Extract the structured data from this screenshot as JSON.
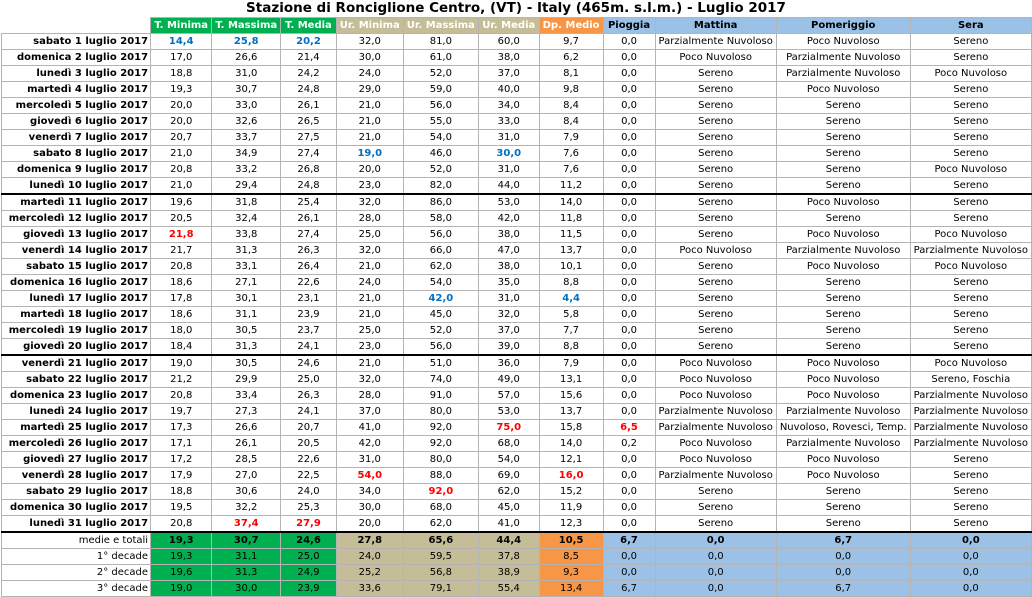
{
  "title": "Stazione di Ronciglione Centro, (VT) - Italy (465m. s.l.m.) - Luglio 2017",
  "headers": [
    "",
    "T. Minima",
    "T. Massima",
    "T. Media",
    "Ur. Minima",
    "Ur. Massima",
    "Ur. Media",
    "Dp. Medio",
    "Pioggia",
    "Mattina",
    "Pomeriggio",
    "Sera"
  ],
  "rows": [
    {
      "date": "sabato 1 luglio 2017",
      "v": [
        "14,4",
        "25,8",
        "20,2",
        "32,0",
        "81,0",
        "60,0",
        "9,7",
        "0,0",
        "Parzialmente Nuvoloso",
        "Poco Nuvoloso",
        "Sereno"
      ]
    },
    {
      "date": "domenica 2 luglio 2017",
      "v": [
        "17,0",
        "26,6",
        "21,4",
        "30,0",
        "61,0",
        "38,0",
        "6,2",
        "0,0",
        "Poco Nuvoloso",
        "Parzialmente Nuvoloso",
        "Sereno"
      ]
    },
    {
      "date": "lunedì 3 luglio 2017",
      "v": [
        "18,8",
        "31,0",
        "24,2",
        "24,0",
        "52,0",
        "37,0",
        "8,1",
        "0,0",
        "Sereno",
        "Parzialmente Nuvoloso",
        "Poco Nuvoloso"
      ]
    },
    {
      "date": "martedì 4 luglio 2017",
      "v": [
        "19,3",
        "30,7",
        "24,8",
        "29,0",
        "59,0",
        "40,0",
        "9,8",
        "0,0",
        "Sereno",
        "Poco Nuvoloso",
        "Sereno"
      ]
    },
    {
      "date": "mercoledì 5 luglio 2017",
      "v": [
        "20,0",
        "33,0",
        "26,1",
        "21,0",
        "56,0",
        "34,0",
        "8,4",
        "0,0",
        "Sereno",
        "Sereno",
        "Sereno"
      ]
    },
    {
      "date": "giovedì 6 luglio 2017",
      "v": [
        "20,0",
        "32,6",
        "26,5",
        "21,0",
        "55,0",
        "33,0",
        "8,4",
        "0,0",
        "Sereno",
        "Sereno",
        "Sereno"
      ]
    },
    {
      "date": "venerdì 7 luglio 2017",
      "v": [
        "20,7",
        "33,7",
        "27,5",
        "21,0",
        "54,0",
        "31,0",
        "7,9",
        "0,0",
        "Sereno",
        "Sereno",
        "Sereno"
      ]
    },
    {
      "date": "sabato 8 luglio 2017",
      "v": [
        "21,0",
        "34,9",
        "27,4",
        "19,0",
        "46,0",
        "30,0",
        "7,6",
        "0,0",
        "Sereno",
        "Sereno",
        "Sereno"
      ]
    },
    {
      "date": "domenica 9 luglio 2017",
      "v": [
        "20,8",
        "33,2",
        "26,8",
        "20,0",
        "52,0",
        "31,0",
        "7,6",
        "0,0",
        "Sereno",
        "Sereno",
        "Poco Nuvoloso"
      ]
    },
    {
      "date": "lunedì 10 luglio 2017",
      "v": [
        "21,0",
        "29,4",
        "24,8",
        "23,0",
        "82,0",
        "44,0",
        "11,2",
        "0,0",
        "Sereno",
        "Sereno",
        "Sereno"
      ]
    },
    {
      "date": "martedì 11 luglio 2017",
      "v": [
        "19,6",
        "31,8",
        "25,4",
        "32,0",
        "86,0",
        "53,0",
        "14,0",
        "0,0",
        "Sereno",
        "Poco Nuvoloso",
        "Sereno"
      ]
    },
    {
      "date": "mercoledì 12 luglio 2017",
      "v": [
        "20,5",
        "32,4",
        "26,1",
        "28,0",
        "58,0",
        "42,0",
        "11,8",
        "0,0",
        "Sereno",
        "Sereno",
        "Sereno"
      ]
    },
    {
      "date": "giovedì 13 luglio 2017",
      "v": [
        "21,8",
        "33,8",
        "27,4",
        "25,0",
        "56,0",
        "38,0",
        "11,5",
        "0,0",
        "Sereno",
        "Poco Nuvoloso",
        "Poco Nuvoloso"
      ]
    },
    {
      "date": "venerdì 14 luglio 2017",
      "v": [
        "21,7",
        "31,3",
        "26,3",
        "32,0",
        "66,0",
        "47,0",
        "13,7",
        "0,0",
        "Poco Nuvoloso",
        "Parzialmente Nuvoloso",
        "Parzialmente Nuvoloso"
      ]
    },
    {
      "date": "sabato 15 luglio 2017",
      "v": [
        "20,8",
        "33,1",
        "26,4",
        "21,0",
        "62,0",
        "38,0",
        "10,1",
        "0,0",
        "Sereno",
        "Poco Nuvoloso",
        "Poco Nuvoloso"
      ]
    },
    {
      "date": "domenica 16 luglio 2017",
      "v": [
        "18,6",
        "27,1",
        "22,6",
        "24,0",
        "54,0",
        "35,0",
        "8,8",
        "0,0",
        "Sereno",
        "Sereno",
        "Sereno"
      ]
    },
    {
      "date": "lunedì 17 luglio 2017",
      "v": [
        "17,8",
        "30,1",
        "23,1",
        "21,0",
        "42,0",
        "31,0",
        "4,4",
        "0,0",
        "Sereno",
        "Sereno",
        "Sereno"
      ]
    },
    {
      "date": "martedì 18 luglio 2017",
      "v": [
        "18,6",
        "31,1",
        "23,9",
        "21,0",
        "45,0",
        "32,0",
        "5,8",
        "0,0",
        "Sereno",
        "Sereno",
        "Sereno"
      ]
    },
    {
      "date": "mercoledì 19 luglio 2017",
      "v": [
        "18,0",
        "30,5",
        "23,7",
        "25,0",
        "52,0",
        "37,0",
        "7,7",
        "0,0",
        "Sereno",
        "Sereno",
        "Sereno"
      ]
    },
    {
      "date": "giovedì 20 luglio 2017",
      "v": [
        "18,4",
        "31,3",
        "24,1",
        "23,0",
        "56,0",
        "39,0",
        "8,8",
        "0,0",
        "Sereno",
        "Sereno",
        "Sereno"
      ]
    },
    {
      "date": "venerdì 21 luglio 2017",
      "v": [
        "19,0",
        "30,5",
        "24,6",
        "21,0",
        "51,0",
        "36,0",
        "7,9",
        "0,0",
        "Poco Nuvoloso",
        "Poco Nuvoloso",
        "Poco Nuvoloso"
      ]
    },
    {
      "date": "sabato 22 luglio 2017",
      "v": [
        "21,2",
        "29,9",
        "25,0",
        "32,0",
        "74,0",
        "49,0",
        "13,1",
        "0,0",
        "Poco Nuvoloso",
        "Poco Nuvoloso",
        "Sereno, Foschia"
      ]
    },
    {
      "date": "domenica 23 luglio 2017",
      "v": [
        "20,8",
        "33,4",
        "26,3",
        "28,0",
        "91,0",
        "57,0",
        "15,6",
        "0,0",
        "Poco Nuvoloso",
        "Poco Nuvoloso",
        "Parzialmente Nuvoloso"
      ]
    },
    {
      "date": "lunedì 24 luglio 2017",
      "v": [
        "19,7",
        "27,3",
        "24,1",
        "37,0",
        "80,0",
        "53,0",
        "13,7",
        "0,0",
        "Parzialmente Nuvoloso",
        "Parzialmente Nuvoloso",
        "Parzialmente Nuvoloso"
      ]
    },
    {
      "date": "martedì 25 luglio 2017",
      "v": [
        "17,3",
        "26,6",
        "20,7",
        "41,0",
        "92,0",
        "75,0",
        "15,8",
        "6,5",
        "Parzialmente Nuvoloso",
        "Nuvoloso, Rovesci, Temp.",
        "Parzialmente Nuvoloso"
      ]
    },
    {
      "date": "mercoledì 26 luglio 2017",
      "v": [
        "17,1",
        "26,1",
        "20,5",
        "42,0",
        "92,0",
        "68,0",
        "14,0",
        "0,2",
        "Poco Nuvoloso",
        "Parzialmente Nuvoloso",
        "Parzialmente Nuvoloso"
      ]
    },
    {
      "date": "giovedì 27 luglio 2017",
      "v": [
        "17,2",
        "28,5",
        "22,6",
        "31,0",
        "80,0",
        "54,0",
        "12,1",
        "0,0",
        "Poco Nuvoloso",
        "Poco Nuvoloso",
        "Sereno"
      ]
    },
    {
      "date": "venerdì 28 luglio 2017",
      "v": [
        "17,9",
        "27,0",
        "22,5",
        "54,0",
        "88,0",
        "69,0",
        "16,0",
        "0,0",
        "Parzialmente Nuvoloso",
        "Poco Nuvoloso",
        "Sereno"
      ]
    },
    {
      "date": "sabato 29 luglio 2017",
      "v": [
        "18,8",
        "30,6",
        "24,0",
        "34,0",
        "92,0",
        "62,0",
        "15,2",
        "0,0",
        "Sereno",
        "Sereno",
        "Sereno"
      ]
    },
    {
      "date": "domenica 30 luglio 2017",
      "v": [
        "19,5",
        "32,2",
        "25,3",
        "30,0",
        "68,0",
        "45,0",
        "11,9",
        "0,0",
        "Sereno",
        "Sereno",
        "Sereno"
      ]
    },
    {
      "date": "lunedì 31 luglio 2017",
      "v": [
        "20,8",
        "37,4",
        "27,9",
        "20,0",
        "62,0",
        "41,0",
        "12,3",
        "0,0",
        "Sereno",
        "Sereno",
        "Sereno"
      ]
    }
  ],
  "highlights": {
    "blue": [
      [
        0,
        0
      ],
      [
        0,
        1
      ],
      [
        0,
        2
      ],
      [
        7,
        3
      ],
      [
        7,
        5
      ],
      [
        16,
        4
      ],
      [
        16,
        6
      ]
    ],
    "red": [
      [
        12,
        0
      ],
      [
        30,
        1
      ],
      [
        30,
        2
      ],
      [
        27,
        3
      ],
      [
        24,
        5
      ],
      [
        28,
        4
      ],
      [
        27,
        6
      ],
      [
        24,
        7
      ]
    ]
  },
  "summary": [
    {
      "label": "medie e totali",
      "v": [
        "19,3",
        "30,7",
        "24,6",
        "27,8",
        "65,6",
        "44,4",
        "10,5",
        "6,7",
        "0,0",
        "6,7",
        "0,0"
      ]
    },
    {
      "label": "1° decade",
      "v": [
        "19,3",
        "31,1",
        "25,0",
        "24,0",
        "59,5",
        "37,8",
        "8,5",
        "0,0",
        "0,0",
        "0,0",
        "0,0"
      ]
    },
    {
      "label": "2° decade",
      "v": [
        "19,6",
        "31,3",
        "24,9",
        "25,2",
        "56,8",
        "38,9",
        "9,3",
        "0,0",
        "0,0",
        "0,0",
        "0,0"
      ]
    },
    {
      "label": "3° decade",
      "v": [
        "19,0",
        "30,0",
        "23,9",
        "33,6",
        "79,1",
        "55,4",
        "13,4",
        "6,7",
        "0,0",
        "6,7",
        "0,0"
      ]
    }
  ],
  "colors": {
    "green": "#00b050",
    "tan": "#c4bd97",
    "orange": "#f79646",
    "blue": "#9bc2e6"
  }
}
